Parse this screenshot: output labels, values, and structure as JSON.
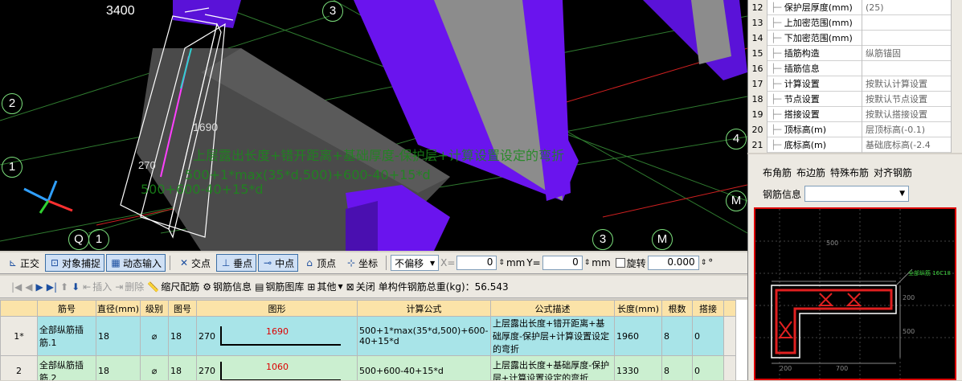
{
  "viewport": {
    "dim_3400": "3400",
    "dim_1690": "1690",
    "dim_270": "270",
    "axes": [
      "3",
      "2",
      "4",
      "1",
      "M",
      "Q",
      "1",
      "3",
      "M",
      "M"
    ],
    "overlay": {
      "line1": "上层露出长度+错开距离+基础厚度-保护层+计算设置设定的弯折",
      "line2": "500+1*max(35*d,500)+600-40+15*d",
      "line3": "500+600-40+15*d"
    }
  },
  "toolbar1": {
    "ortho": "正交",
    "snap": "对象捕捉",
    "dyn_input": "动态输入",
    "intersection": "交点",
    "perpendicular": "垂点",
    "midpoint": "中点",
    "vertex": "顶点",
    "coord": "坐标",
    "offset_mode": "不偏移",
    "x_label": "X=",
    "x_value": "0",
    "y_label": "Y=",
    "y_value": "0",
    "unit": "mm",
    "rotate_label": "旋转",
    "rotate_value": "0.000",
    "degree": "°"
  },
  "toolbar2": {
    "insert": "插入",
    "delete": "删除",
    "scale_rebar": "缩尺配筋",
    "rebar_info": "钢筋信息",
    "rebar_lib": "钢筋图库",
    "other": "其他",
    "close": "关闭",
    "total_weight": "单构件钢筋总重(kg)：56.543"
  },
  "grid": {
    "headers": [
      "筋号",
      "直径(mm)",
      "级别",
      "图号",
      "图形",
      "计算公式",
      "公式描述",
      "长度(mm)",
      "根数",
      "搭接"
    ],
    "rows": [
      {
        "idx": "1*",
        "name": "全部纵筋插筋.1",
        "dia": "18",
        "grade": "⌀",
        "fig": "18",
        "shape_left": "270",
        "shape_len": "1690",
        "formula": "500+1*max(35*d,500)+600-40+15*d",
        "desc": "上层露出长度+错开距离+基础厚度-保护层+计算设置设定的弯折",
        "length": "1960",
        "count": "8",
        "lap": "0"
      },
      {
        "idx": "2",
        "name": "全部纵筋插筋.2",
        "dia": "18",
        "grade": "⌀",
        "fig": "18",
        "shape_left": "270",
        "shape_len": "1060",
        "formula": "500+600-40+15*d",
        "desc": "上层露出长度+基础厚度-保护层+计算设置设定的弯折",
        "length": "1330",
        "count": "8",
        "lap": "0"
      }
    ]
  },
  "props": [
    {
      "n": "12",
      "name": "保护层厚度(mm)",
      "val": "(25)"
    },
    {
      "n": "13",
      "name": "上加密范围(mm)",
      "val": ""
    },
    {
      "n": "14",
      "name": "下加密范围(mm)",
      "val": ""
    },
    {
      "n": "15",
      "name": "插筋构造",
      "val": "纵筋锚固"
    },
    {
      "n": "16",
      "name": "插筋信息",
      "val": ""
    },
    {
      "n": "17",
      "name": "计算设置",
      "val": "按默认计算设置"
    },
    {
      "n": "18",
      "name": "节点设置",
      "val": "按默认节点设置"
    },
    {
      "n": "19",
      "name": "搭接设置",
      "val": "按默认搭接设置"
    },
    {
      "n": "20",
      "name": "顶标高(m)",
      "val": "层顶标高(-0.1)"
    },
    {
      "n": "21",
      "name": "底标高(m)",
      "val": "基础底标高(-2.4"
    }
  ],
  "right": {
    "tabs": [
      "布角筋",
      "布边筋",
      "特殊布筋",
      "对齐钢筋"
    ],
    "rebar_info_label": "钢筋信息",
    "preview_dims": {
      "top": "500",
      "right1": "200",
      "right2": "500",
      "bottom1": "200",
      "bottom2": "700",
      "tag": "全部纵筋 16C18"
    }
  },
  "colors": {
    "purple": "#5a12d8",
    "selected_row": "#a8e4e8",
    "row2": "#cbefd0",
    "header": "#fbe3a8"
  }
}
